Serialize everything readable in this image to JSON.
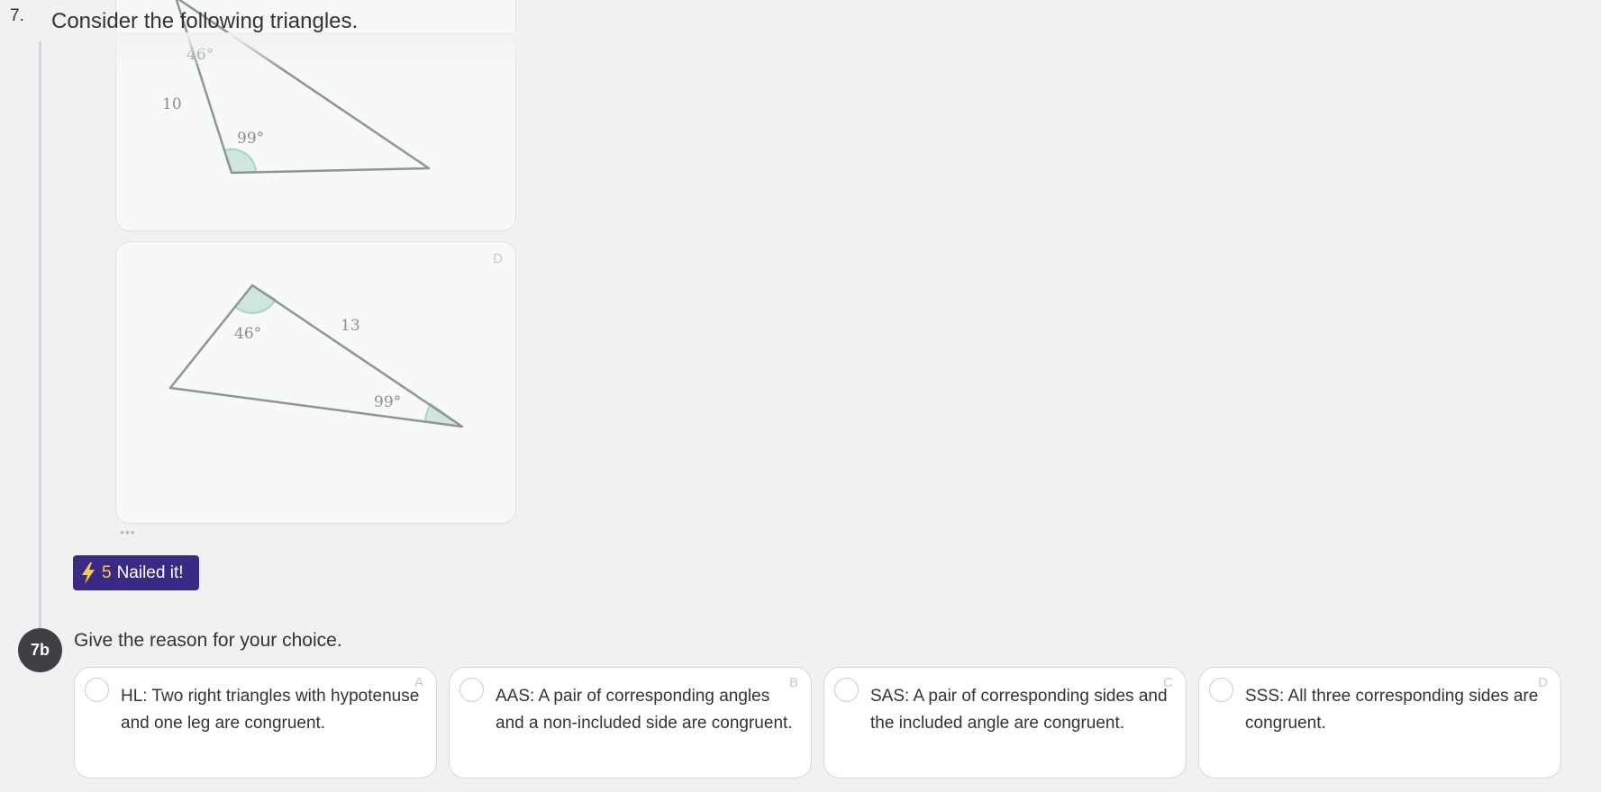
{
  "question": {
    "number": "7.",
    "title": "Consider the following triangles."
  },
  "cards": [
    {
      "letter": "",
      "labels": {
        "top_angle": "46°",
        "side": "10",
        "bottom_angle": "99°"
      }
    },
    {
      "letter": "D",
      "labels": {
        "top_angle": "46°",
        "side": "13",
        "right_angle": "99°"
      }
    }
  ],
  "more_indicator": "•••",
  "badge": {
    "icon": "lightning-icon",
    "points": "5",
    "label": "Nailed it!"
  },
  "subquestion": {
    "tag": "7b",
    "title": "Give the reason for your choice."
  },
  "options": [
    {
      "letter": "A",
      "text": "HL: Two right triangles with hypotenuse and one leg are congruent."
    },
    {
      "letter": "B",
      "text": "AAS: A pair of corresponding angles and a non-included side are congruent."
    },
    {
      "letter": "C",
      "text": "SAS: A pair of corresponding sides and the included angle are congruent."
    },
    {
      "letter": "D",
      "text": "SSS: All three corresponding sides are congruent."
    }
  ],
  "colors": {
    "badge_bg": "#3a2a86",
    "badge_points": "#f9c74f",
    "angle_fill": "#cfe6df",
    "triangle_stroke": "#8f9597"
  }
}
